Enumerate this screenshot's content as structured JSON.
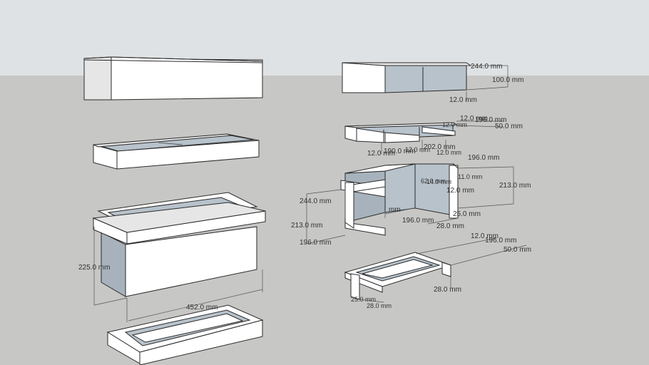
{
  "colors": {
    "sky": "#dfe2e4",
    "ground": "#c7c7c5",
    "face_light": "#ffffff",
    "face_mid": "#e6e6e6",
    "face_dark": "#cfd1d3",
    "glass": "#b7c2cb",
    "glass_dark": "#a7b2bc",
    "edge": "#2a2a2a"
  },
  "dims": {
    "d1": "244.0 mm",
    "d2": "100.0 mm",
    "d3": "12.0 mm",
    "d4": "12.0 mm",
    "d5": "196.0 mm",
    "d6": "50.0 mm",
    "d7": "12.0 mm",
    "d8": "190.0 mm",
    "d9": "202.0 mm",
    "d10": "12.0 mm",
    "d11": "12.0 mm",
    "d12": "196.0 mm",
    "d13": "213.0 mm",
    "d14": "62.0 mm",
    "d15": "14.0 mm",
    "d16": "11.0 mm",
    "d17": "12.0 mm",
    "d18": "25.0 mm",
    "d19": "28.0 mm",
    "d20": "196.0 mm",
    "d21": "244.0 mm",
    "d22": "213.0 mm",
    "d23": "196.0 mm",
    "d24": "mm",
    "d25": "12.0 mm",
    "d26": "196.0 mm",
    "d27": "50.0 mm",
    "d28": "28.0 mm",
    "d29": "25.0 mm",
    "d30": "28.0 mm",
    "d31": "225.0 mm",
    "d32": "452.0 mm"
  }
}
